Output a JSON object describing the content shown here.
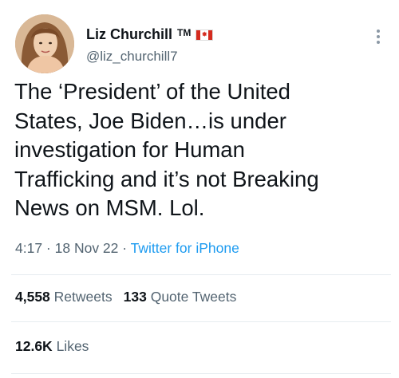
{
  "user": {
    "display_name": "Liz Churchill",
    "tm": "TM",
    "flag_icon": "canada-flag-icon",
    "handle": "@liz_churchill7"
  },
  "tweet": {
    "lines": [
      "The ‘President’ of the United",
      "States, Joe Biden…is under",
      "investigation for Human",
      "Trafficking and it’s not Breaking",
      "News on MSM. Lol."
    ],
    "time": "4:17",
    "date": "18 Nov 22",
    "separator": " · ",
    "source": "Twitter for iPhone"
  },
  "stats": {
    "retweets_count": "4,558",
    "retweets_label": "Retweets",
    "quotes_count": "133",
    "quotes_label": "Quote Tweets",
    "likes_count": "12.6K",
    "likes_label": "Likes"
  },
  "colors": {
    "text": "#0f1419",
    "secondary": "#536471",
    "link": "#1d9bf0",
    "flag_red": "#d52b1e"
  }
}
